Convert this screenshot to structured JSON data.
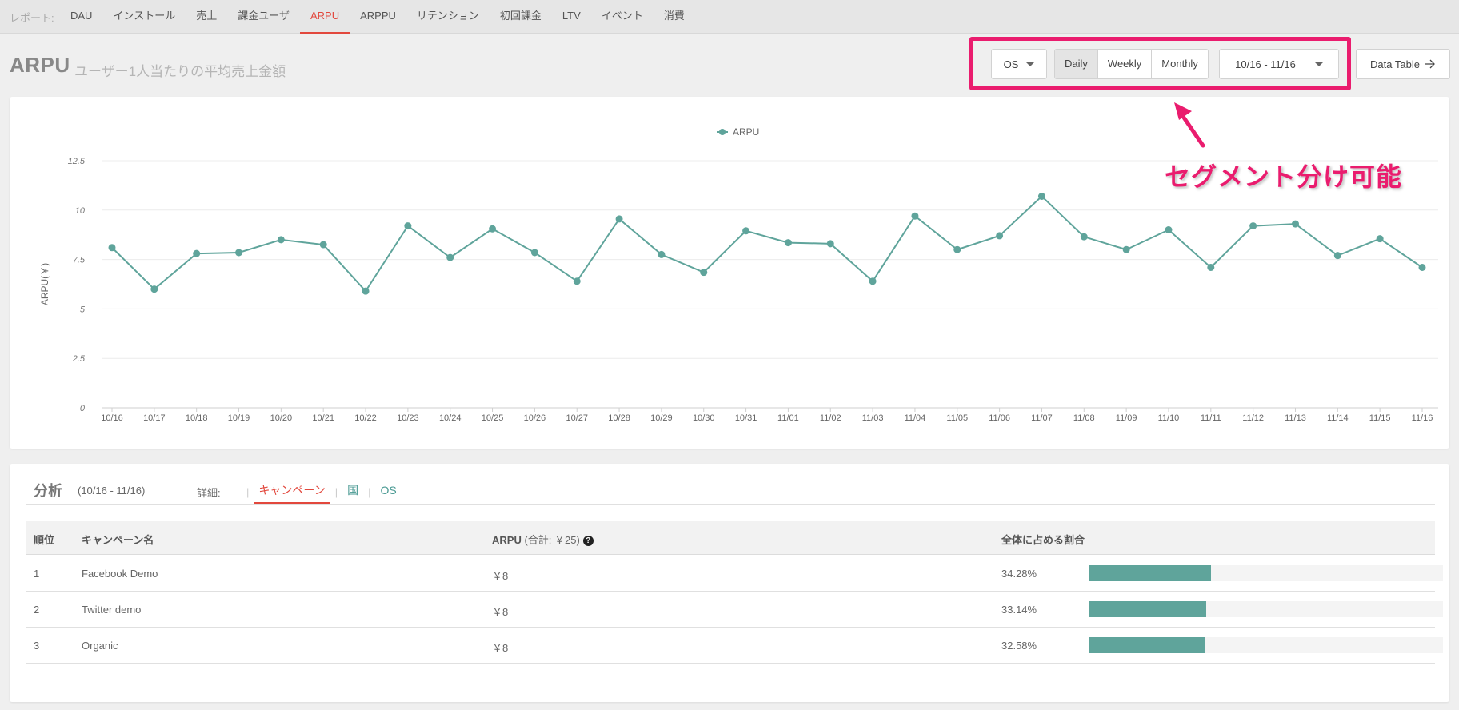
{
  "nav": {
    "label": "レポート:",
    "tabs": [
      "DAU",
      "インストール",
      "売上",
      "課金ユーザ",
      "ARPU",
      "ARPPU",
      "リテンション",
      "初回課金",
      "LTV",
      "イベント",
      "消費"
    ],
    "active": "ARPU"
  },
  "header": {
    "title": "ARPU",
    "subtitle": "ユーザー1人当たりの平均売上金額"
  },
  "controls": {
    "os_label": "OS",
    "granularity": [
      "Daily",
      "Weekly",
      "Monthly"
    ],
    "active_granularity": "Daily",
    "date_range": "10/16 - 11/16",
    "data_table_label": "Data Table",
    "data_table_icon": "arrow-right-icon"
  },
  "annotation": {
    "text": "セグメント分け可能",
    "color": "#ea1c6e"
  },
  "chart_data": {
    "type": "line",
    "legend": "ARPU",
    "legend_position": "top-center",
    "ylabel": "ARPU(￥)",
    "xlabel": "",
    "ylim": [
      0,
      12.5
    ],
    "yticks": [
      "0",
      "2.5",
      "5",
      "7.5",
      "10",
      "12.5"
    ],
    "grid": true,
    "color": "#5fa49b",
    "x": [
      "10/16",
      "10/17",
      "10/18",
      "10/19",
      "10/20",
      "10/21",
      "10/22",
      "10/23",
      "10/24",
      "10/25",
      "10/26",
      "10/27",
      "10/28",
      "10/29",
      "10/30",
      "10/31",
      "11/01",
      "11/02",
      "11/03",
      "11/04",
      "11/05",
      "11/06",
      "11/07",
      "11/08",
      "11/09",
      "11/10",
      "11/11",
      "11/12",
      "11/13",
      "11/14",
      "11/15",
      "11/16"
    ],
    "series": [
      {
        "name": "ARPU",
        "values": [
          8.1,
          6.0,
          7.8,
          7.85,
          8.5,
          8.25,
          5.9,
          9.2,
          7.6,
          9.05,
          7.85,
          6.4,
          9.55,
          7.75,
          6.85,
          8.95,
          8.35,
          8.3,
          6.4,
          9.7,
          8.0,
          8.7,
          10.7,
          8.65,
          8.0,
          9.0,
          7.1,
          9.2,
          9.3,
          7.7,
          8.55,
          7.1
        ]
      }
    ]
  },
  "analysis": {
    "title": "分析",
    "range": "(10/16 - 11/16)",
    "detail_label": "詳細:",
    "tabs": [
      "キャンペーン",
      "国",
      "OS"
    ],
    "active_tab": "キャンペーン",
    "columns": {
      "rank": "順位",
      "name": "キャンペーン名",
      "arpu": "ARPU",
      "arpu_total": "(合計: ￥25)",
      "share": "全体に占める割合"
    },
    "rows": [
      {
        "rank": "1",
        "name": "Facebook Demo",
        "arpu": "￥8",
        "share": "34.28%",
        "share_value": 0.3428
      },
      {
        "rank": "2",
        "name": "Twitter demo",
        "arpu": "￥8",
        "share": "33.14%",
        "share_value": 0.3314
      },
      {
        "rank": "3",
        "name": "Organic",
        "arpu": "￥8",
        "share": "32.58%",
        "share_value": 0.3258
      }
    ]
  }
}
